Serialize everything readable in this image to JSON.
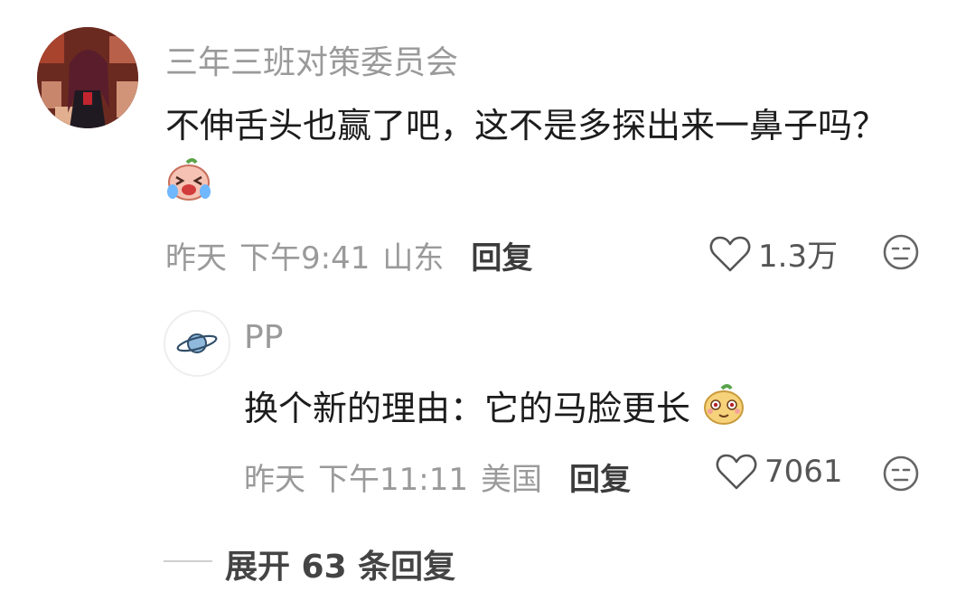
{
  "comment": {
    "username": "三年三班对策委员会",
    "content": "不伸舌头也赢了吧，这不是多探出来一鼻子吗？",
    "date": "昨天",
    "time": "下午9:41",
    "location": "山东",
    "reply_label": "回复",
    "likes": "1.3万",
    "emoji_icon": "crying-laughing-emoji"
  },
  "reply": {
    "username": "PP",
    "content": "换个新的理由：它的马脸更长",
    "date": "昨天",
    "time": "下午11:11",
    "location": "美国",
    "reply_label": "回复",
    "likes": "7061",
    "emoji_icon": "smirk-emoji"
  },
  "expand_label": "展开 63 条回复"
}
